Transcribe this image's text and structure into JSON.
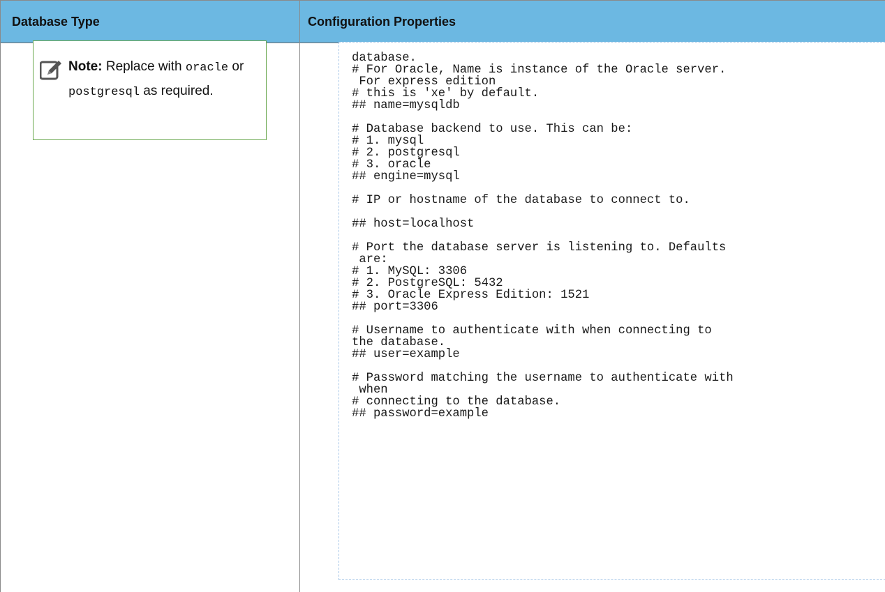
{
  "table": {
    "headers": {
      "database_type": "Database Type",
      "configuration_properties": "Configuration Properties"
    }
  },
  "note": {
    "label": "Note:",
    "text_before": " Replace with ",
    "code1": "oracle",
    "or": " or ",
    "code2": "postgresql",
    "text_after": " as required.",
    "icon": "edit-note-icon"
  },
  "code": {
    "content": "database.\n# For Oracle, Name is instance of the Oracle server.\n For express edition\n# this is 'xe' by default.\n## name=mysqldb\n\n# Database backend to use. This can be:\n# 1. mysql\n# 2. postgresql\n# 3. oracle\n## engine=mysql\n\n# IP or hostname of the database to connect to.\n\n## host=localhost\n\n# Port the database server is listening to. Defaults\n are:\n# 1. MySQL: 3306\n# 2. PostgreSQL: 5432\n# 3. Oracle Express Edition: 1521\n## port=3306\n\n# Username to authenticate with when connecting to\nthe database.\n## user=example\n\n# Password matching the username to authenticate with\n when\n# connecting to the database.\n## password=example"
  },
  "colors": {
    "header_bg": "#6cb8e2",
    "note_border": "#6aa84f",
    "code_border": "#a9c8e8"
  }
}
